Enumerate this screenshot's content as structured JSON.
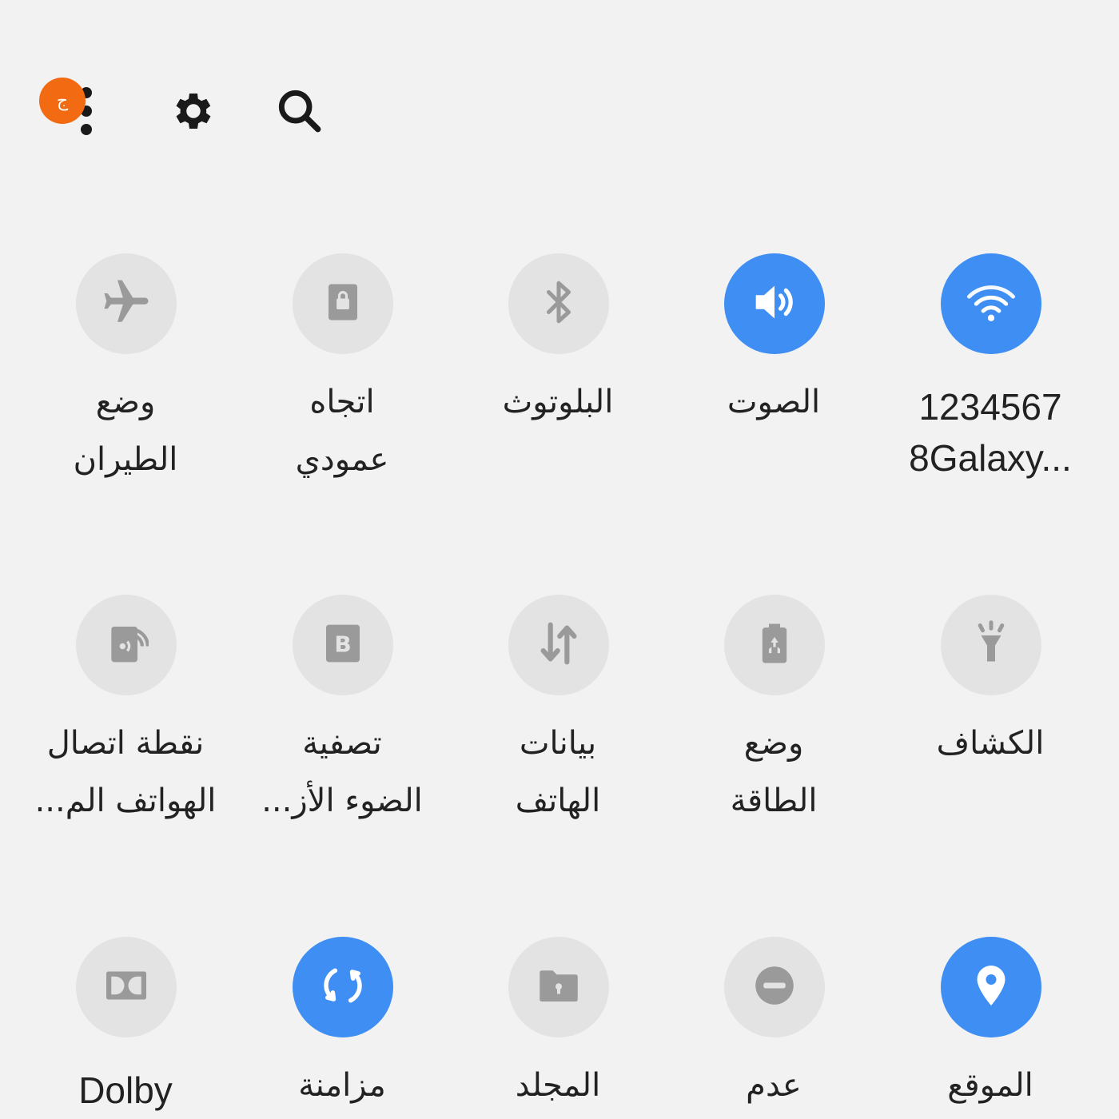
{
  "header": {
    "badge_text": "ج",
    "icons": [
      "more-options-icon",
      "gear-icon",
      "search-icon"
    ]
  },
  "colors": {
    "background": "#f2f2f2",
    "tile_on": "#3e8ef3",
    "tile_off": "#e3e3e3",
    "icon_off": "#9a9a9a",
    "badge": "#f26b12"
  },
  "tiles": [
    {
      "icon": "wifi-icon",
      "active": true,
      "line1": "1234567",
      "line2": "8Galaxy..."
    },
    {
      "icon": "sound-icon",
      "active": true,
      "line1": "الصوت",
      "line2": ""
    },
    {
      "icon": "bluetooth-icon",
      "active": false,
      "line1": "البلوتوث",
      "line2": ""
    },
    {
      "icon": "portrait-lock-icon",
      "active": false,
      "line1": "اتجاه",
      "line2": "عمودي"
    },
    {
      "icon": "airplane-icon",
      "active": false,
      "line1": "وضع",
      "line2": "الطيران"
    },
    {
      "icon": "flashlight-icon",
      "active": false,
      "line1": "الكشاف",
      "line2": ""
    },
    {
      "icon": "power-saving-icon",
      "active": false,
      "line1": "وضع",
      "line2": "الطاقة"
    },
    {
      "icon": "mobile-data-icon",
      "active": false,
      "line1": "بيانات",
      "line2": "الهاتف"
    },
    {
      "icon": "blue-light-filter-icon",
      "active": false,
      "line1": "تصفية",
      "line2": "الضوء الأز..."
    },
    {
      "icon": "hotspot-icon",
      "active": false,
      "line1": "نقطة اتصال",
      "line2": "الهواتف الم..."
    },
    {
      "icon": "location-icon",
      "active": true,
      "line1": "الموقع",
      "line2": ""
    },
    {
      "icon": "do-not-disturb-icon",
      "active": false,
      "line1": "عدم",
      "line2": ""
    },
    {
      "icon": "secure-folder-icon",
      "active": false,
      "line1": "المجلد",
      "line2": ""
    },
    {
      "icon": "sync-icon",
      "active": true,
      "line1": "مزامنة",
      "line2": ""
    },
    {
      "icon": "dolby-icon",
      "active": false,
      "line1": "Dolby",
      "line2": ""
    }
  ]
}
